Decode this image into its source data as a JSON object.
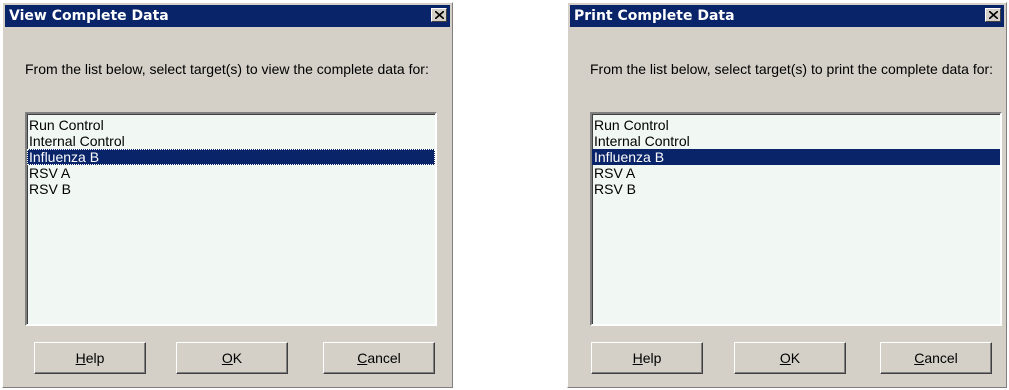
{
  "view_dialog": {
    "title": "View Complete Data",
    "instructions": "From the list below, select target(s) to view the complete data for:",
    "targets": [
      "Run Control",
      "Internal Control",
      "Influenza B",
      "RSV A",
      "RSV B"
    ],
    "selected_target": "Influenza B",
    "buttons": {
      "help": {
        "mnemonic": "H",
        "rest": "elp"
      },
      "ok": {
        "mnemonic": "O",
        "rest": "K"
      },
      "cancel": {
        "mnemonic": "C",
        "rest": "ancel"
      }
    },
    "close_icon": "close-icon"
  },
  "print_dialog": {
    "title": "Print Complete Data",
    "instructions": "From the list below, select target(s) to print the complete data for:",
    "targets": [
      "Run Control",
      "Internal Control",
      "Influenza B",
      "RSV A",
      "RSV B"
    ],
    "selected_target": "Influenza B",
    "buttons": {
      "help": {
        "mnemonic": "H",
        "rest": "elp"
      },
      "ok": {
        "mnemonic": "O",
        "rest": "K"
      },
      "cancel": {
        "mnemonic": "C",
        "rest": "ancel"
      }
    },
    "close_icon": "close-icon"
  },
  "colors": {
    "dialog_face": "#d4d0c8",
    "titlebar": "#0a246a",
    "list_background": "#f1f7f3",
    "selection": "#0a246a"
  }
}
